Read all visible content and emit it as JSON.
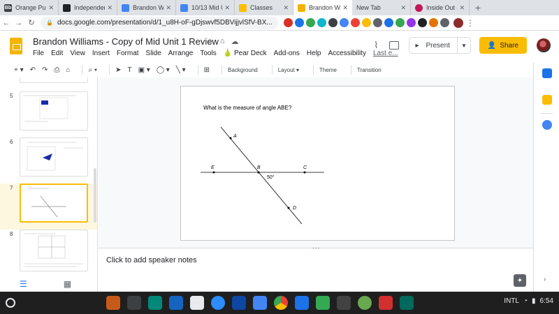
{
  "tabs": [
    {
      "label": "Orange Publi",
      "fav": "Bb",
      "color": "#3c4043"
    },
    {
      "label": "Independent",
      "fav": "",
      "color": "#202124"
    },
    {
      "label": "Brandon Wil",
      "fav": "",
      "color": "#4285f4"
    },
    {
      "label": "10/13 Mid U",
      "fav": "",
      "color": "#4285f4"
    },
    {
      "label": "Classes",
      "fav": "",
      "color": "#fbbc04"
    },
    {
      "label": "Brandon Wil",
      "fav": "",
      "color": "#f4b400",
      "active": true
    },
    {
      "label": "New Tab",
      "fav": "",
      "color": ""
    },
    {
      "label": "Inside Out &",
      "fav": "",
      "color": "#c2185b"
    }
  ],
  "address": {
    "url": "docs.google.com/presentation/d/1_u8H-oF-gDjswvf5DBVijjvlSfV-BX..."
  },
  "doc": {
    "title": "Brandon Williams - Copy of Mid Unit 1  Review",
    "menus": [
      "File",
      "Edit",
      "View",
      "Insert",
      "Format",
      "Slide",
      "Arrange",
      "Tools",
      "Pear Deck",
      "Add-ons",
      "Help",
      "Accessibility"
    ],
    "last_edit": "Last e..."
  },
  "header_buttons": {
    "present": "Present",
    "share": "Share"
  },
  "toolbar": {
    "background": "Background",
    "layout": "Layout",
    "theme": "Theme",
    "transition": "Transition"
  },
  "filmstrip": {
    "slides": [
      "5",
      "6",
      "7",
      "8"
    ],
    "selected": "7"
  },
  "slide": {
    "question": "What is the measure of angle ABE?",
    "labels": {
      "a": "A",
      "b": "B",
      "c": "C",
      "d": "D",
      "e": "E"
    },
    "angle": "50°"
  },
  "notes": {
    "placeholder": "Click to add speaker notes"
  },
  "system": {
    "input_method": "INTL",
    "clock": "6:54"
  }
}
